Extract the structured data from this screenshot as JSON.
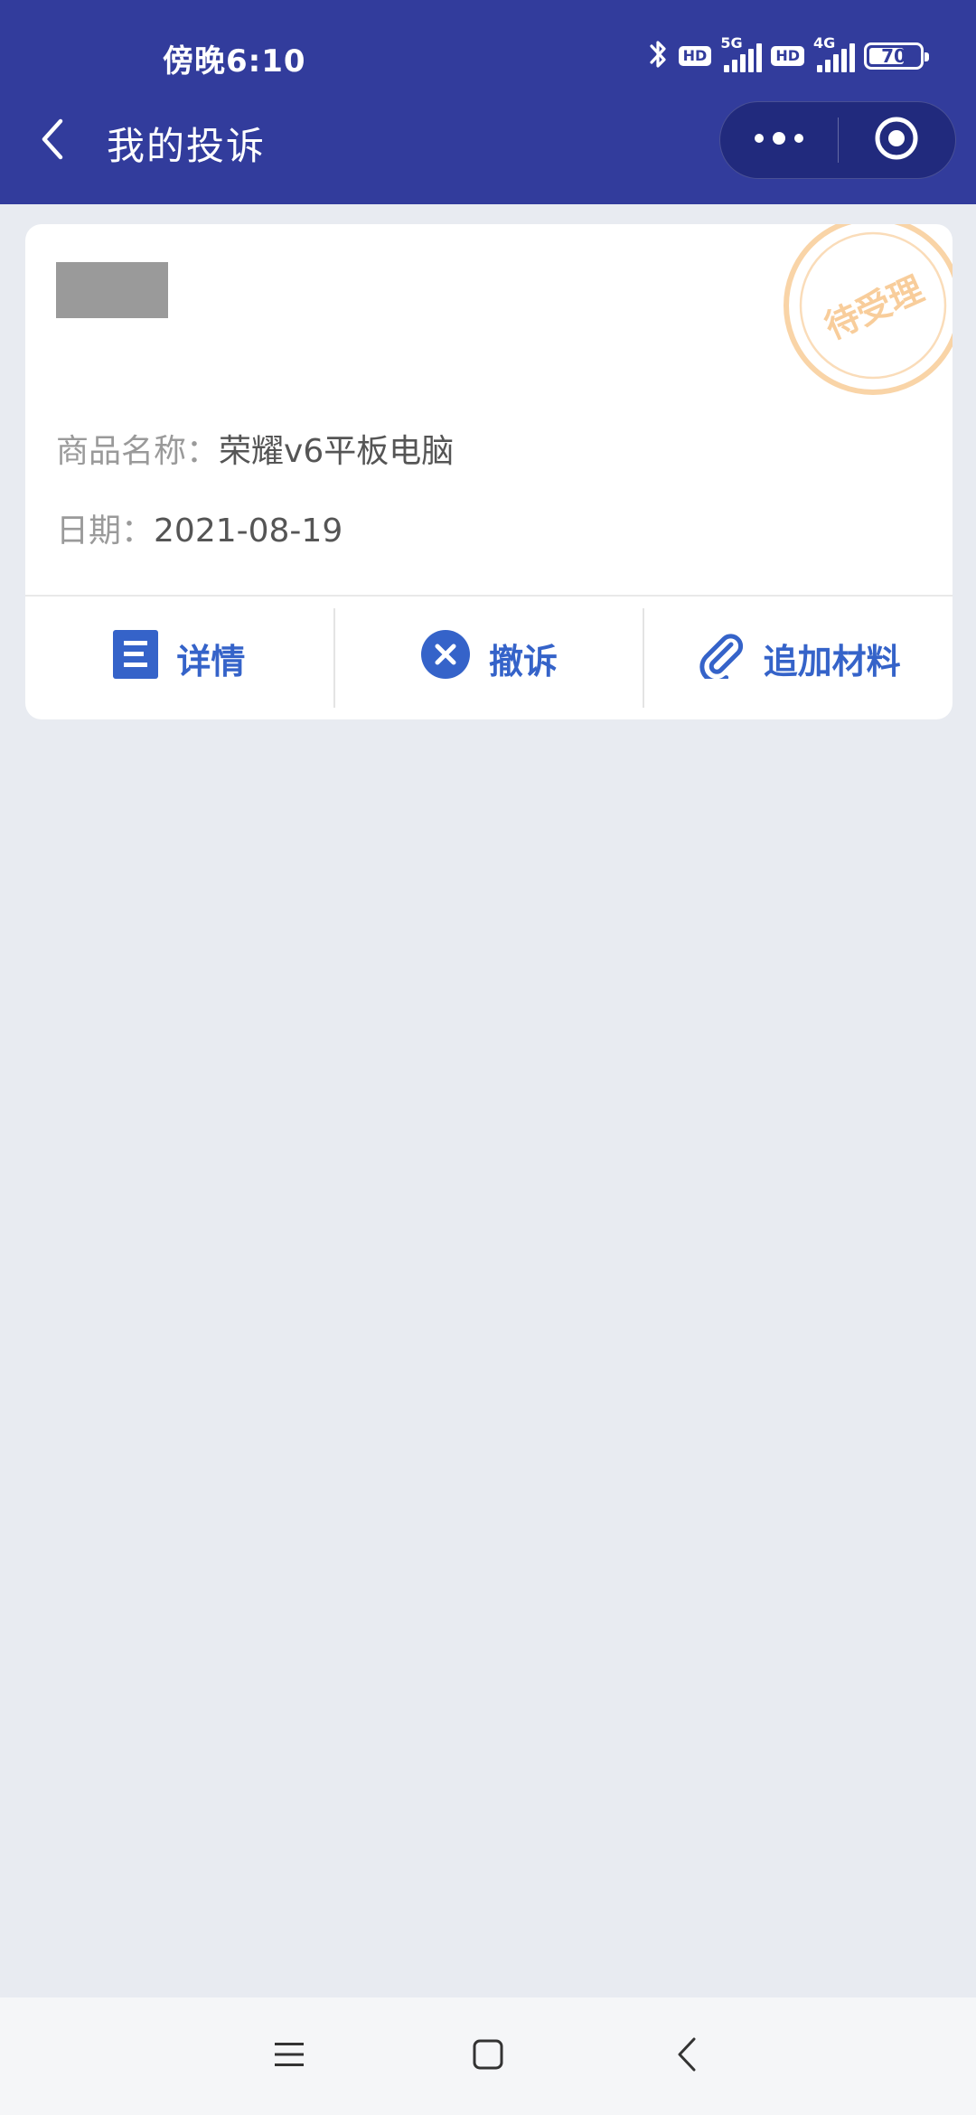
{
  "status_bar": {
    "time": "傍晚6:10",
    "icons": [
      "bluetooth-icon",
      "hd-icon",
      "5g-signal-icon",
      "hd-icon",
      "4g-signal-icon",
      "battery-icon"
    ],
    "hd_label": "HD",
    "network_1": "5G",
    "network_2": "4G",
    "battery_level": "70"
  },
  "header": {
    "back_icon": "chevron-left-icon",
    "title": "我的投诉",
    "more_icon": "more-dots-icon",
    "close_icon": "target-circle-icon"
  },
  "complaint": {
    "stamp_text": "待受理",
    "stamp_color": "#f7c58a",
    "product_label": "商品名称：",
    "product_value": "荣耀v6平板电脑",
    "date_label": "日期：",
    "date_value": "2021-08-19",
    "actions": [
      {
        "label": "详情",
        "icon": "document-icon"
      },
      {
        "label": "撤诉",
        "icon": "close-circle-icon"
      },
      {
        "label": "追加材料",
        "icon": "paperclip-icon"
      }
    ]
  },
  "colors": {
    "header_bg": "#323c9c",
    "accent": "#3563c9",
    "page_bg": "#e8ebf1"
  },
  "navbar": {
    "icons": [
      "menu-icon",
      "home-square-icon",
      "back-triangle-icon"
    ]
  }
}
